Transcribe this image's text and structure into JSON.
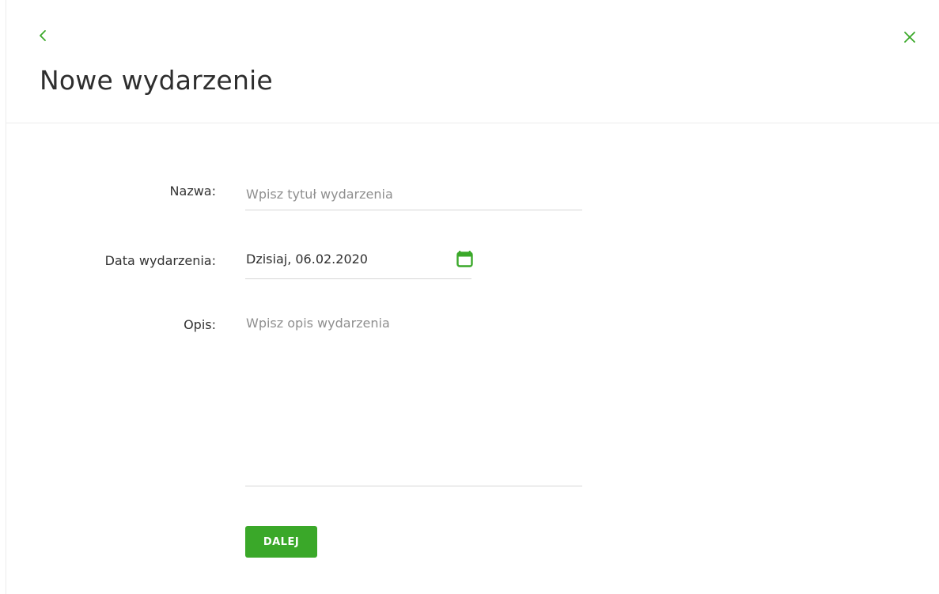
{
  "header": {
    "title": "Nowe wydarzenie",
    "back_icon": "chevron-left-icon",
    "close_icon": "close-icon"
  },
  "form": {
    "name_label": "Nazwa:",
    "name_placeholder": "Wpisz tytuł wydarzenia",
    "name_value": "",
    "date_label": "Data wydarzenia:",
    "date_value": "Dzisiaj, 06.02.2020",
    "date_icon": "calendar-icon",
    "description_label": "Opis:",
    "description_placeholder": "Wpisz opis wydarzenia",
    "description_value": ""
  },
  "actions": {
    "next_label": "DALEJ"
  },
  "colors": {
    "accent": "#3aa829",
    "border": "#d6d6d6",
    "placeholder": "#8f8f8f",
    "text": "#2e2e2e"
  }
}
